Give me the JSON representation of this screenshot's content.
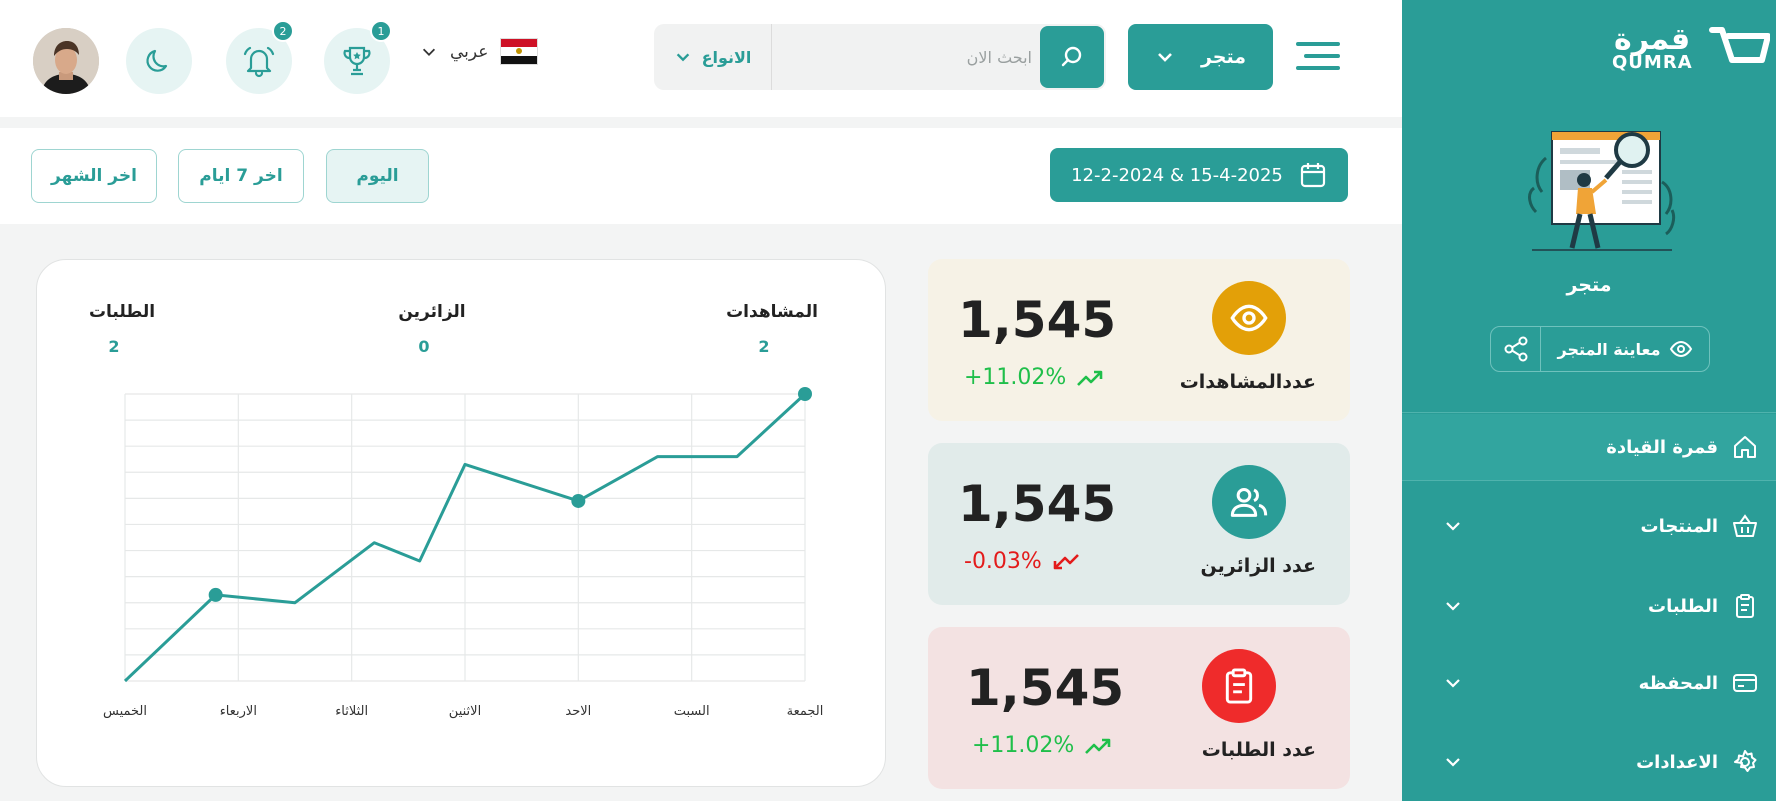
{
  "colors": {
    "primary": "#2a9d97",
    "positive": "#1fbf4a",
    "negative": "#e31b1b",
    "views_icon": "#e3a008",
    "orders_icon": "#ef2b2b"
  },
  "sidebar": {
    "logo_ar": "قمرة",
    "logo_en": "QUMRA",
    "store_name": "متجر",
    "preview_label": "معاينة المتجر",
    "items": [
      {
        "label": "قمرة القيادة",
        "icon": "home-icon",
        "active": true
      },
      {
        "label": "المنتجات",
        "icon": "basket-icon"
      },
      {
        "label": "الطلبات",
        "icon": "clipboard-icon"
      },
      {
        "label": "المحفظه",
        "icon": "wallet-icon"
      },
      {
        "label": "الاعدادات",
        "icon": "gear-icon"
      }
    ]
  },
  "header": {
    "store_select": "متجر",
    "search_placeholder": "ابحث الان",
    "types_label": "الانواع",
    "language": "عربي",
    "trophy_badge": "1",
    "bell_badge": "2"
  },
  "filters": {
    "date_range": "12-2-2024 & 15-4-2025",
    "today": "اليوم",
    "last_7_days": "اخر 7 ايام",
    "last_month": "اخر الشهر"
  },
  "stats": [
    {
      "label": "عددالمشاهدات",
      "value": "1,545",
      "change": "+11.02%",
      "trend": "up",
      "icon": "eye-icon"
    },
    {
      "label": "عدد الزائرين",
      "value": "1,545",
      "change": "-0.03%",
      "trend": "down",
      "icon": "users-icon"
    },
    {
      "label": "عدد الطلبات",
      "value": "1,545",
      "change": "+11.02%",
      "trend": "up",
      "icon": "clipboard-icon"
    }
  ],
  "chart_data": {
    "type": "line",
    "summary": [
      {
        "label": "المشاهدات",
        "value": "2"
      },
      {
        "label": "الزائرين",
        "value": "0"
      },
      {
        "label": "الطلبات",
        "value": "2"
      }
    ],
    "categories": [
      "الخميس",
      "الاربعاء",
      "الثلاثاء",
      "الاثنين",
      "الاحد",
      "السبت",
      "الجمعة"
    ],
    "x": [
      0,
      0.8,
      1.5,
      2.2,
      2.6,
      3.0,
      4.0,
      4.7,
      5.4,
      6.0
    ],
    "values": [
      0,
      3.3,
      3.0,
      5.3,
      4.6,
      8.3,
      6.9,
      8.6,
      8.6,
      11.0
    ],
    "markers": [
      1,
      6,
      9
    ],
    "ylim": [
      0,
      11
    ],
    "grid": true
  }
}
